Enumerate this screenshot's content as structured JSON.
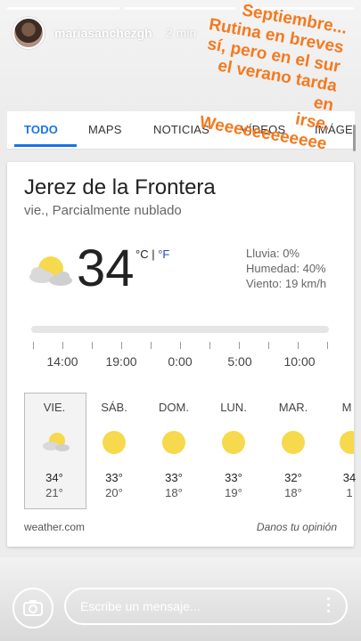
{
  "story": {
    "username": "mariasanchezgh",
    "time_ago": "2 min",
    "overlay_text": "Septiembre...\nRutina en breves\nsí, pero en el sur\nel verano tarda en\nirse.\nWeeeeeeeeeeee",
    "overlay_color": "#f47a1f",
    "message_placeholder": "Escribe un mensaje..."
  },
  "search": {
    "tabs": [
      "TODO",
      "MAPS",
      "NOTICIAS",
      "VÍDEOS",
      "IMÁGE"
    ],
    "active_tab": "TODO",
    "accent": "#1a73e8"
  },
  "weather": {
    "location": "Jerez de la Frontera",
    "condition": "vie., Parcialmente nublado",
    "temperature": "34",
    "unit_c": "°C",
    "unit_sep": "|",
    "unit_f": "°F",
    "precipitation": "Lluvia: 0%",
    "humidity": "Humedad: 40%",
    "wind": "Viento: 19 km/h",
    "current_icon": "partly-cloudy-icon",
    "hours": [
      "14:00",
      "19:00",
      "0:00",
      "5:00",
      "10:00"
    ],
    "days": [
      {
        "name": "VIE.",
        "icon": "partly-cloudy-icon",
        "high": "34°",
        "low": "21°"
      },
      {
        "name": "SÁB.",
        "icon": "sun-icon",
        "high": "33°",
        "low": "20°"
      },
      {
        "name": "DOM.",
        "icon": "sun-icon",
        "high": "33°",
        "low": "18°"
      },
      {
        "name": "LUN.",
        "icon": "sun-icon",
        "high": "33°",
        "low": "19°"
      },
      {
        "name": "MAR.",
        "icon": "sun-icon",
        "high": "32°",
        "low": "18°"
      },
      {
        "name": "M",
        "icon": "sun-icon",
        "high": "34",
        "low": "1"
      }
    ],
    "source": "weather.com",
    "feedback": "Danos tu opinión"
  }
}
